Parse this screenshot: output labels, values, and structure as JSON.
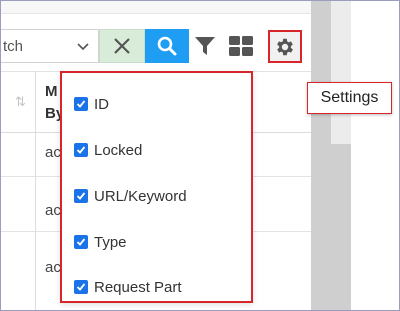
{
  "toolbar": {
    "search_value": "tch",
    "settings_tooltip": "Settings"
  },
  "table": {
    "header_col": [
      "M",
      "By"
    ],
    "rows": [
      "ac",
      "ac",
      "ac"
    ]
  },
  "column_chooser": {
    "options": [
      {
        "label": "ID",
        "checked": true
      },
      {
        "label": "Locked",
        "checked": true
      },
      {
        "label": "URL/Keyword",
        "checked": true
      },
      {
        "label": "Type",
        "checked": true
      },
      {
        "label": "Request Part",
        "checked": true
      }
    ]
  },
  "colors": {
    "accent_blue": "#1e9df2",
    "checkbox_blue": "#1a73e8",
    "highlight_red": "#d6252b",
    "clear_green": "#d9ecd9"
  },
  "icons": [
    "chevron-down-icon",
    "close-icon",
    "search-icon",
    "filter-icon",
    "grid-icon",
    "gear-icon",
    "sort-icon",
    "checkmark-icon"
  ]
}
